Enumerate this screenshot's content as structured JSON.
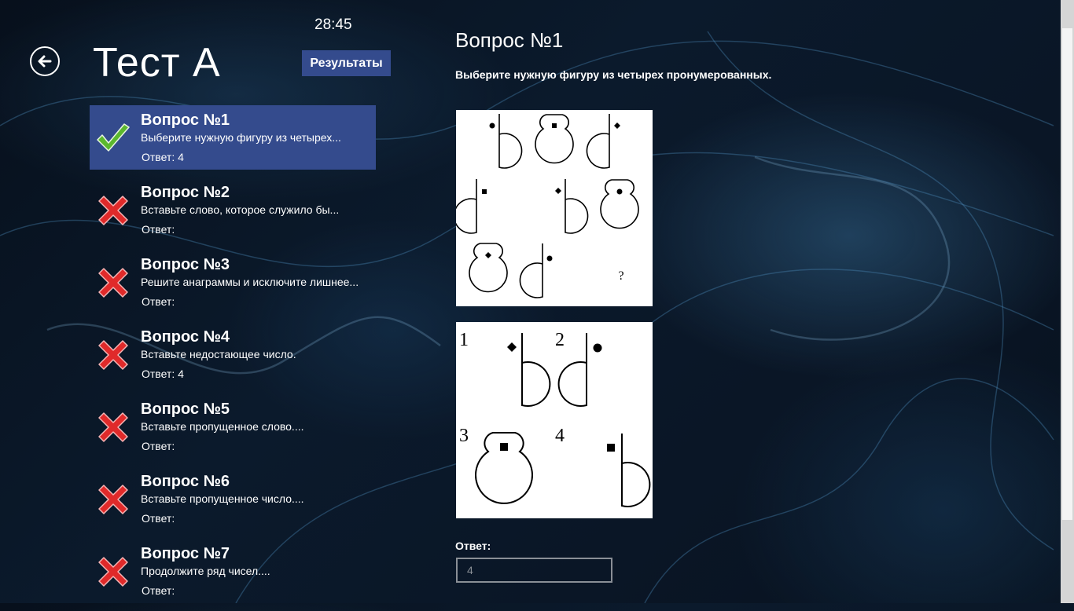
{
  "header": {
    "title": "Тест А",
    "timer": "28:45",
    "results_label": "Результаты"
  },
  "questions": [
    {
      "title": "Вопрос №1",
      "description": "Выберите нужную фигуру из четырех...",
      "answer": "Ответ: 4",
      "status": "correct",
      "selected": true
    },
    {
      "title": "Вопрос №2",
      "description": "Вставьте слово, которое служило бы...",
      "answer": "Ответ:",
      "status": "wrong"
    },
    {
      "title": "Вопрос №3",
      "description": "Решите анаграммы и исключите лишнее...",
      "answer": "Ответ:",
      "status": "wrong"
    },
    {
      "title": "Вопрос №4",
      "description": "Вставьте недостающее число.",
      "answer": "Ответ: 4",
      "status": "wrong"
    },
    {
      "title": "Вопрос №5",
      "description": "Вставьте пропущенное слово....",
      "answer": "Ответ:",
      "status": "wrong"
    },
    {
      "title": "Вопрос №6",
      "description": "Вставьте пропущенное число....",
      "answer": "Ответ:",
      "status": "wrong"
    },
    {
      "title": "Вопрос №7",
      "description": "Продолжите ряд чисел....",
      "answer": "Ответ:",
      "status": "wrong"
    }
  ],
  "detail": {
    "heading": "Вопрос №1",
    "text": "Выберите нужную фигуру из четырех пронумерованных.",
    "grid_question_mark": "?",
    "option_numbers": [
      "1",
      "2",
      "3",
      "4"
    ],
    "answer_label": "Ответ:",
    "answer_value": "4"
  },
  "icons": {
    "back": "back-arrow-icon",
    "correct": "checkmark-icon",
    "wrong": "red-cross-icon"
  },
  "colors": {
    "selected_bg": "#344b8d",
    "button_bg": "#344b8d",
    "check_green": "#5cb82e",
    "cross_red": "#e02a2a"
  }
}
